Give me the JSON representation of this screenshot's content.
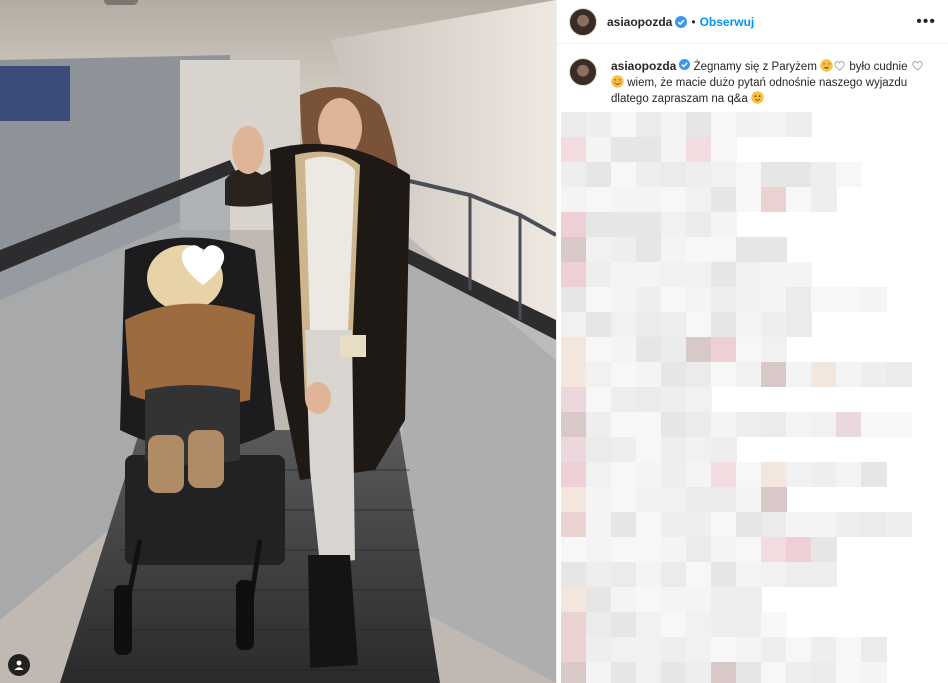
{
  "post": {
    "username": "asiaopozda",
    "separator": "•",
    "follow_label": "Obserwuj",
    "more_label": "•••",
    "caption_part1": "Żegnamy się z Paryżem",
    "caption_part2": "było cudnie",
    "caption_part3": "wiem, że macie dużo pytań odnośnie naszego wyjazdu dlatego zapraszam na q&a"
  },
  "colors": {
    "accent": "#0095f6",
    "verified": "#3897f0",
    "text": "#262626",
    "divider": "#efefef"
  },
  "icons": {
    "verified": "verified-badge-icon",
    "tag": "user-tag-icon",
    "more": "more-options-icon"
  }
}
